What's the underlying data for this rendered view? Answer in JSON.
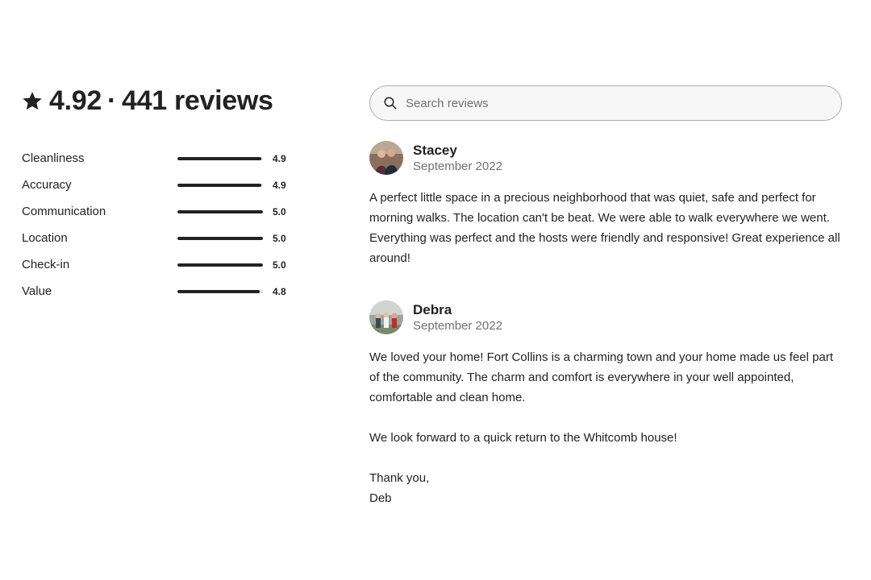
{
  "summary": {
    "rating": "4.92",
    "separator": "·",
    "review_count_text": "441 reviews",
    "categories": [
      {
        "label": "Cleanliness",
        "score": "4.9",
        "fraction": 0.98
      },
      {
        "label": "Accuracy",
        "score": "4.9",
        "fraction": 0.98
      },
      {
        "label": "Communication",
        "score": "5.0",
        "fraction": 1.0
      },
      {
        "label": "Location",
        "score": "5.0",
        "fraction": 1.0
      },
      {
        "label": "Check-in",
        "score": "5.0",
        "fraction": 1.0
      },
      {
        "label": "Value",
        "score": "4.8",
        "fraction": 0.96
      }
    ]
  },
  "search": {
    "placeholder": "Search reviews",
    "value": ""
  },
  "reviews": [
    {
      "name": "Stacey",
      "date": "September 2022",
      "paragraphs": [
        "A perfect little space in a precious neighborhood that was quiet, safe and perfect for morning walks. The location can't be beat. We were able to walk everywhere we went. Everything was perfect and the hosts were friendly and responsive! Great experience all around!"
      ]
    },
    {
      "name": "Debra",
      "date": "September 2022",
      "paragraphs": [
        "We loved your home! Fort Collins is a charming town and your home made us feel part of the community. The charm and comfort is everywhere in your well appointed, comfortable and clean home.",
        "We look forward to a quick return to the Whitcomb house!",
        "Thank you,\nDeb"
      ]
    }
  ],
  "icons": {
    "rating": "star-icon",
    "search": "magnifier-icon"
  },
  "colors": {
    "text": "#222222",
    "muted": "#717171",
    "bar_track": "#dddddd",
    "search_border": "#b0b0b0"
  }
}
